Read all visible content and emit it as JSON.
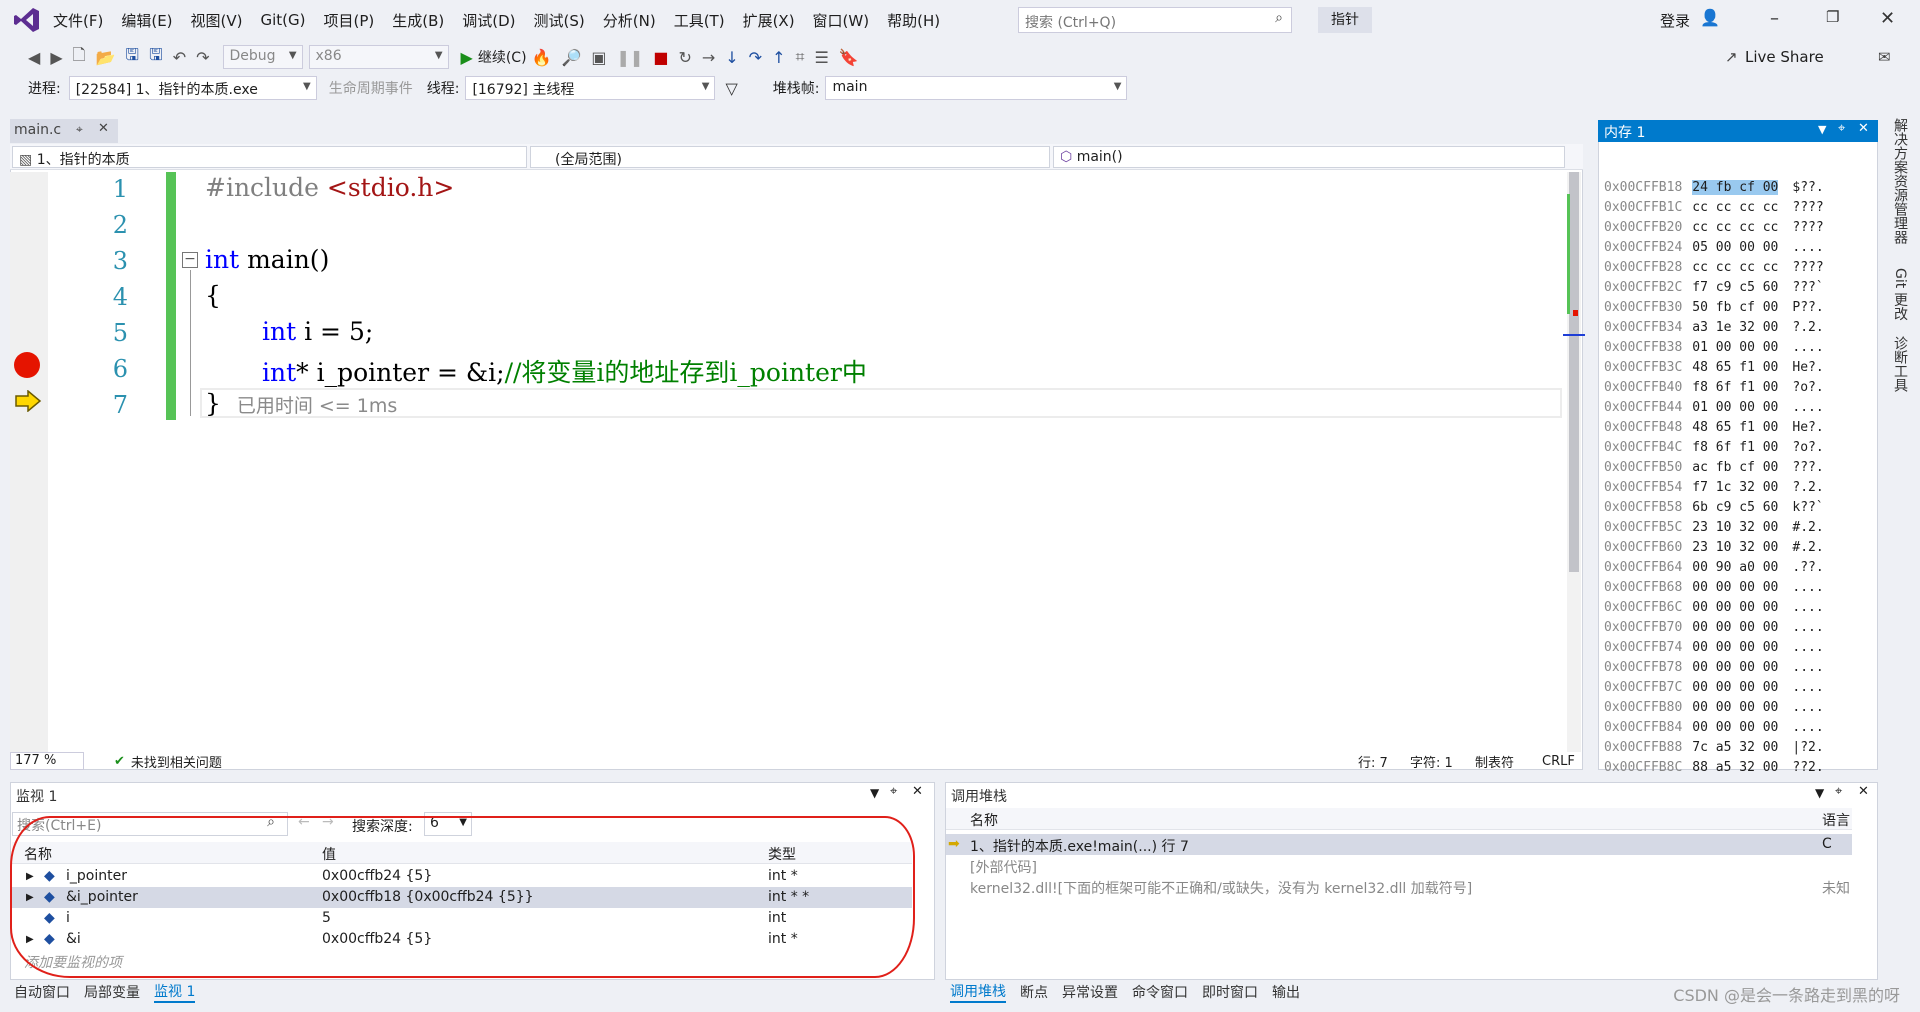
{
  "menubar": {
    "items": [
      "文件(F)",
      "编辑(E)",
      "视图(V)",
      "Git(G)",
      "项目(P)",
      "生成(B)",
      "调试(D)",
      "测试(S)",
      "分析(N)",
      "工具(T)",
      "扩展(X)",
      "窗口(W)",
      "帮助(H)"
    ],
    "search_placeholder": "搜索 (Ctrl+Q)",
    "solution_badge": "指针",
    "login": "登录",
    "live_share": "Live Share"
  },
  "toolbar": {
    "config": "Debug",
    "platform": "x86",
    "continue": "继续(C)"
  },
  "debugbar": {
    "process_label": "进程:",
    "process_value": "[22584] 1、指针的本质.exe",
    "lifecycle": "生命周期事件",
    "thread_label": "线程:",
    "thread_value": "[16792] 主线程",
    "stack_label": "堆栈帧:",
    "stack_value": "main"
  },
  "editor": {
    "tab": "main.c",
    "nav_project": "1、指针的本质",
    "nav_scope": "(全局范围)",
    "nav_func": "main()",
    "lines": [
      "1",
      "2",
      "3",
      "4",
      "5",
      "6",
      "7"
    ],
    "code": {
      "l1_pp": "#include ",
      "l1_str": "<stdio.h>",
      "l3_kw": "int",
      "l3_rest": " main()",
      "l4": "{",
      "l5_kw": "int",
      "l5_rest": " i = 5;",
      "l6_kw": "int",
      "l6_rest": "* i_pointer = &i;",
      "l6_cm": "//将变量i的地址存到i_pointer中",
      "l7": "}",
      "l7_hint": "已用时间 <= 1ms"
    },
    "zoom": "177 %",
    "issues": "未找到相关问题",
    "line_status": "行: 7",
    "char_status": "字符: 1",
    "tab_status": "制表符",
    "eol": "CRLF"
  },
  "memory": {
    "title": "内存 1",
    "rows": [
      [
        "0x00CFFB18",
        "24 fb cf 00",
        "$??."
      ],
      [
        "0x00CFFB1C",
        "cc cc cc cc",
        "????"
      ],
      [
        "0x00CFFB20",
        "cc cc cc cc",
        "????"
      ],
      [
        "0x00CFFB24",
        "05 00 00 00",
        "...."
      ],
      [
        "0x00CFFB28",
        "cc cc cc cc",
        "????"
      ],
      [
        "0x00CFFB2C",
        "f7 c9 c5 60",
        "???`"
      ],
      [
        "0x00CFFB30",
        "50 fb cf 00",
        "P??."
      ],
      [
        "0x00CFFB34",
        "a3 1e 32 00",
        "?.2."
      ],
      [
        "0x00CFFB38",
        "01 00 00 00",
        "...."
      ],
      [
        "0x00CFFB3C",
        "48 65 f1 00",
        "He?."
      ],
      [
        "0x00CFFB40",
        "f8 6f f1 00",
        "?o?."
      ],
      [
        "0x00CFFB44",
        "01 00 00 00",
        "...."
      ],
      [
        "0x00CFFB48",
        "48 65 f1 00",
        "He?."
      ],
      [
        "0x00CFFB4C",
        "f8 6f f1 00",
        "?o?."
      ],
      [
        "0x00CFFB50",
        "ac fb cf 00",
        "???."
      ],
      [
        "0x00CFFB54",
        "f7 1c 32 00",
        "?.2."
      ],
      [
        "0x00CFFB58",
        "6b c9 c5 60",
        "k??`"
      ],
      [
        "0x00CFFB5C",
        "23 10 32 00",
        "#.2."
      ],
      [
        "0x00CFFB60",
        "23 10 32 00",
        "#.2."
      ],
      [
        "0x00CFFB64",
        "00 90 a0 00",
        ".??."
      ],
      [
        "0x00CFFB68",
        "00 00 00 00",
        "...."
      ],
      [
        "0x00CFFB6C",
        "00 00 00 00",
        "...."
      ],
      [
        "0x00CFFB70",
        "00 00 00 00",
        "...."
      ],
      [
        "0x00CFFB74",
        "00 00 00 00",
        "...."
      ],
      [
        "0x00CFFB78",
        "00 00 00 00",
        "...."
      ],
      [
        "0x00CFFB7C",
        "00 00 00 00",
        "...."
      ],
      [
        "0x00CFFB80",
        "00 00 00 00",
        "...."
      ],
      [
        "0x00CFFB84",
        "00 00 00 00",
        "...."
      ],
      [
        "0x00CFFB88",
        "7c a5 32 00",
        "|?2."
      ],
      [
        "0x00CFFB8C",
        "88 a5 32 00",
        "??2."
      ]
    ]
  },
  "right_tabs": [
    "解决方案资源管理器",
    "Git 更改",
    "诊断工具"
  ],
  "watch": {
    "title": "监视 1",
    "search_placeholder": "搜索(Ctrl+E)",
    "depth_label": "搜索深度:",
    "depth_value": "6",
    "col_name": "名称",
    "col_value": "值",
    "col_type": "类型",
    "rows": [
      {
        "name": "i_pointer",
        "value": "0x00cffb24 {5}",
        "type": "int *"
      },
      {
        "name": "&i_pointer",
        "value": "0x00cffb18 {0x00cffb24 {5}}",
        "type": "int * *"
      },
      {
        "name": "i",
        "value": "5",
        "type": "int"
      },
      {
        "name": "&i",
        "value": "0x00cffb24 {5}",
        "type": "int *"
      }
    ],
    "add_hint": "添加要监视的项"
  },
  "callstack": {
    "title": "调用堆栈",
    "col_name": "名称",
    "col_lang": "语言",
    "rows": [
      {
        "name": "1、指针的本质.exe!main(...) 行 7",
        "lang": "C"
      },
      {
        "name": "[外部代码]",
        "lang": ""
      },
      {
        "name": "kernel32.dll![下面的框架可能不正确和/或缺失，没有为 kernel32.dll 加载符号]",
        "lang": "未知"
      }
    ]
  },
  "bottom_tabs_left": [
    "自动窗口",
    "局部变量",
    "监视 1"
  ],
  "bottom_tabs_right": [
    "调用堆栈",
    "断点",
    "异常设置",
    "命令窗口",
    "即时窗口",
    "输出"
  ],
  "watermark": "CSDN @是会一条路走到黑的呀"
}
